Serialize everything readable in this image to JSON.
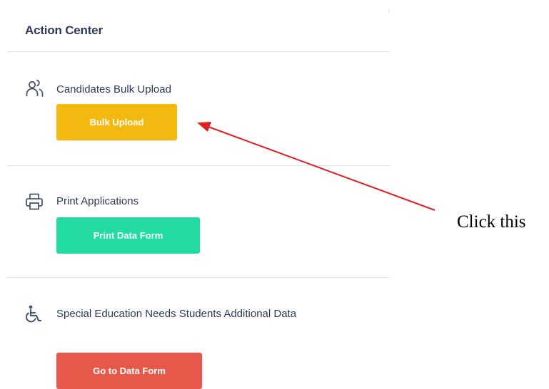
{
  "action_center": {
    "title": "Action Center",
    "items": [
      {
        "icon": "users-icon",
        "label": "Candidates Bulk Upload",
        "button_label": "Bulk Upload",
        "button_color": "#f3b90f"
      },
      {
        "icon": "printer-icon",
        "label": "Print Applications",
        "button_label": "Print Data Form",
        "button_color": "#22dba2"
      },
      {
        "icon": "wheelchair-icon",
        "label": "Special Education Needs Students Additional Data",
        "button_label": "Go to Data Form",
        "button_color": "#e8584a"
      }
    ]
  },
  "annotation": {
    "text": "Click this",
    "arrow_color": "#e02020",
    "target": "Bulk Upload"
  }
}
